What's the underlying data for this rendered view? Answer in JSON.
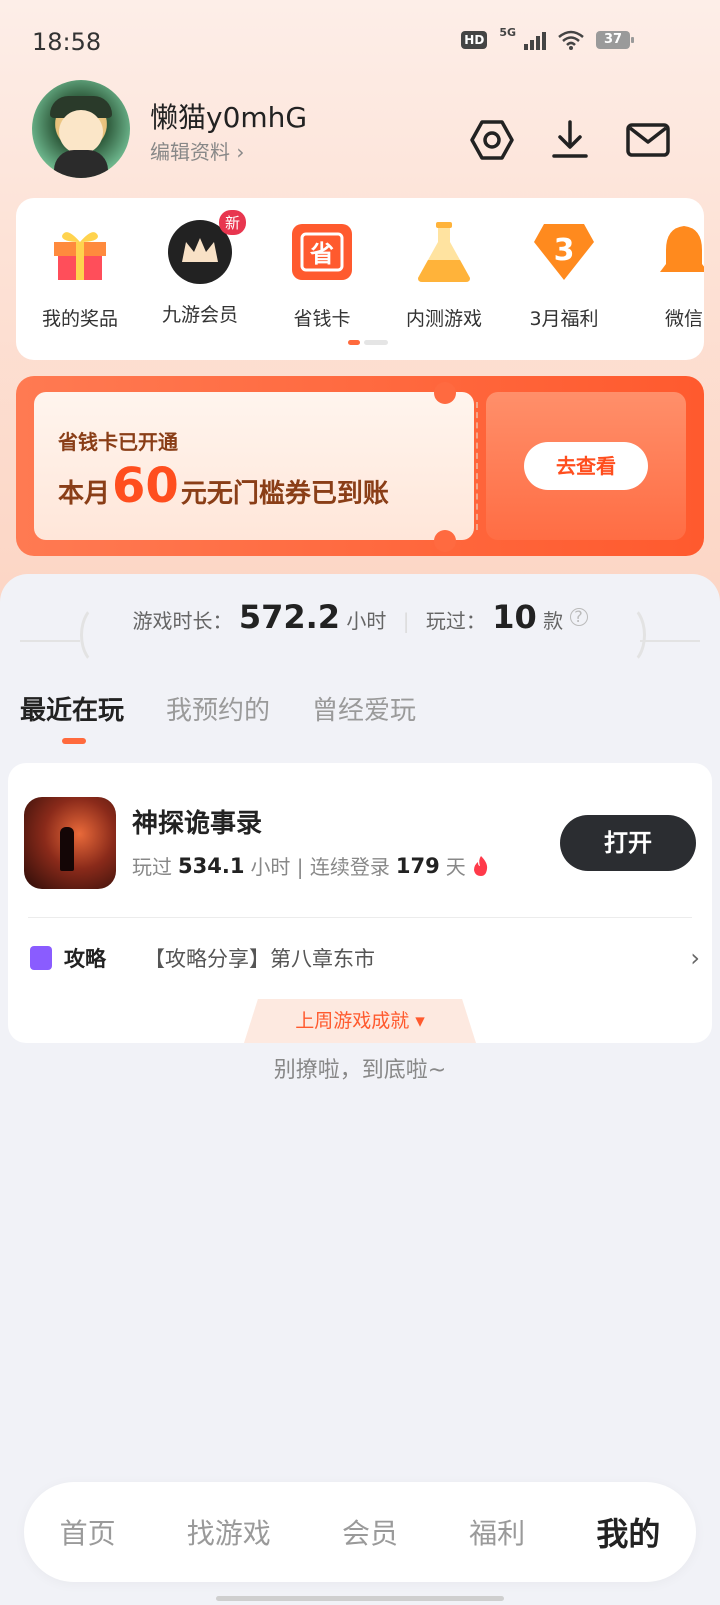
{
  "status": {
    "time": "18:58",
    "hd": "HD",
    "network": "5G",
    "battery": "37"
  },
  "profile": {
    "username": "懒猫y0mhG",
    "edit": "编辑资料 ›"
  },
  "shortcuts": [
    {
      "label": "我的奖品",
      "icon": "gift-icon"
    },
    {
      "label": "九游会员",
      "icon": "crown-icon",
      "badge": "新"
    },
    {
      "label": "省钱卡",
      "icon": "ticket-icon",
      "glyph": "省"
    },
    {
      "label": "内测游戏",
      "icon": "flask-icon"
    },
    {
      "label": "3月福利",
      "icon": "gem-icon",
      "glyph": "3"
    },
    {
      "label": "微信",
      "icon": "bell-icon"
    }
  ],
  "banner": {
    "line1": "省钱卡已开通",
    "line2_pre": "本月",
    "amount": "60",
    "line2_post": "元无门槛券已到账",
    "button": "去查看"
  },
  "stats": {
    "time_label": "游戏时长：",
    "time_value": "572.2",
    "time_unit": "小时",
    "played_label": "玩过：",
    "played_value": "10",
    "played_unit": "款"
  },
  "tabs": [
    "最近在玩",
    "我预约的",
    "曾经爱玩"
  ],
  "game": {
    "title": "神探诡事录",
    "played_prefix": "玩过",
    "hours": "534.1",
    "hours_unit": "小时 | 连续登录",
    "days": "179",
    "days_unit": "天",
    "open": "打开",
    "guide_label": "攻略",
    "guide_text": "【攻略分享】第八章东市",
    "achievement": "上周游戏成就 ▾"
  },
  "end_text": "别撩啦，到底啦~",
  "nav": [
    "首页",
    "找游戏",
    "会员",
    "福利",
    "我的"
  ],
  "colors": {
    "accent": "#ff5a2e",
    "dark_button": "#2b2d31"
  }
}
